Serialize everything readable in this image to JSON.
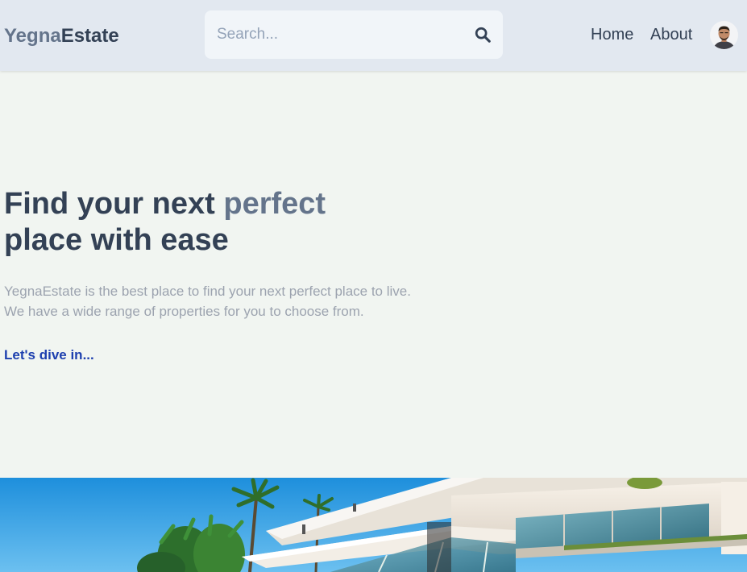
{
  "header": {
    "logo": {
      "part1": "Yegna",
      "part2": "Estate"
    },
    "search": {
      "placeholder": "Search...",
      "value": ""
    },
    "nav": {
      "home": "Home",
      "about": "About"
    }
  },
  "hero": {
    "title_part1": "Find your next ",
    "title_accent": "perfect",
    "title_part2": "place with ease",
    "description_line1": "YegnaEstate is the best place to find your next perfect place to live.",
    "description_line2": "We have a wide range of properties for you to choose from.",
    "cta": "Let's dive in..."
  },
  "icons": {
    "search": "search-icon",
    "avatar": "avatar"
  },
  "colors": {
    "header_bg": "#e2e8f0",
    "page_bg": "#f1f5f1",
    "logo_light": "#64748b",
    "logo_dark": "#334155",
    "text_dark": "#334155",
    "text_muted": "#9ca3af",
    "link": "#1e40af"
  }
}
